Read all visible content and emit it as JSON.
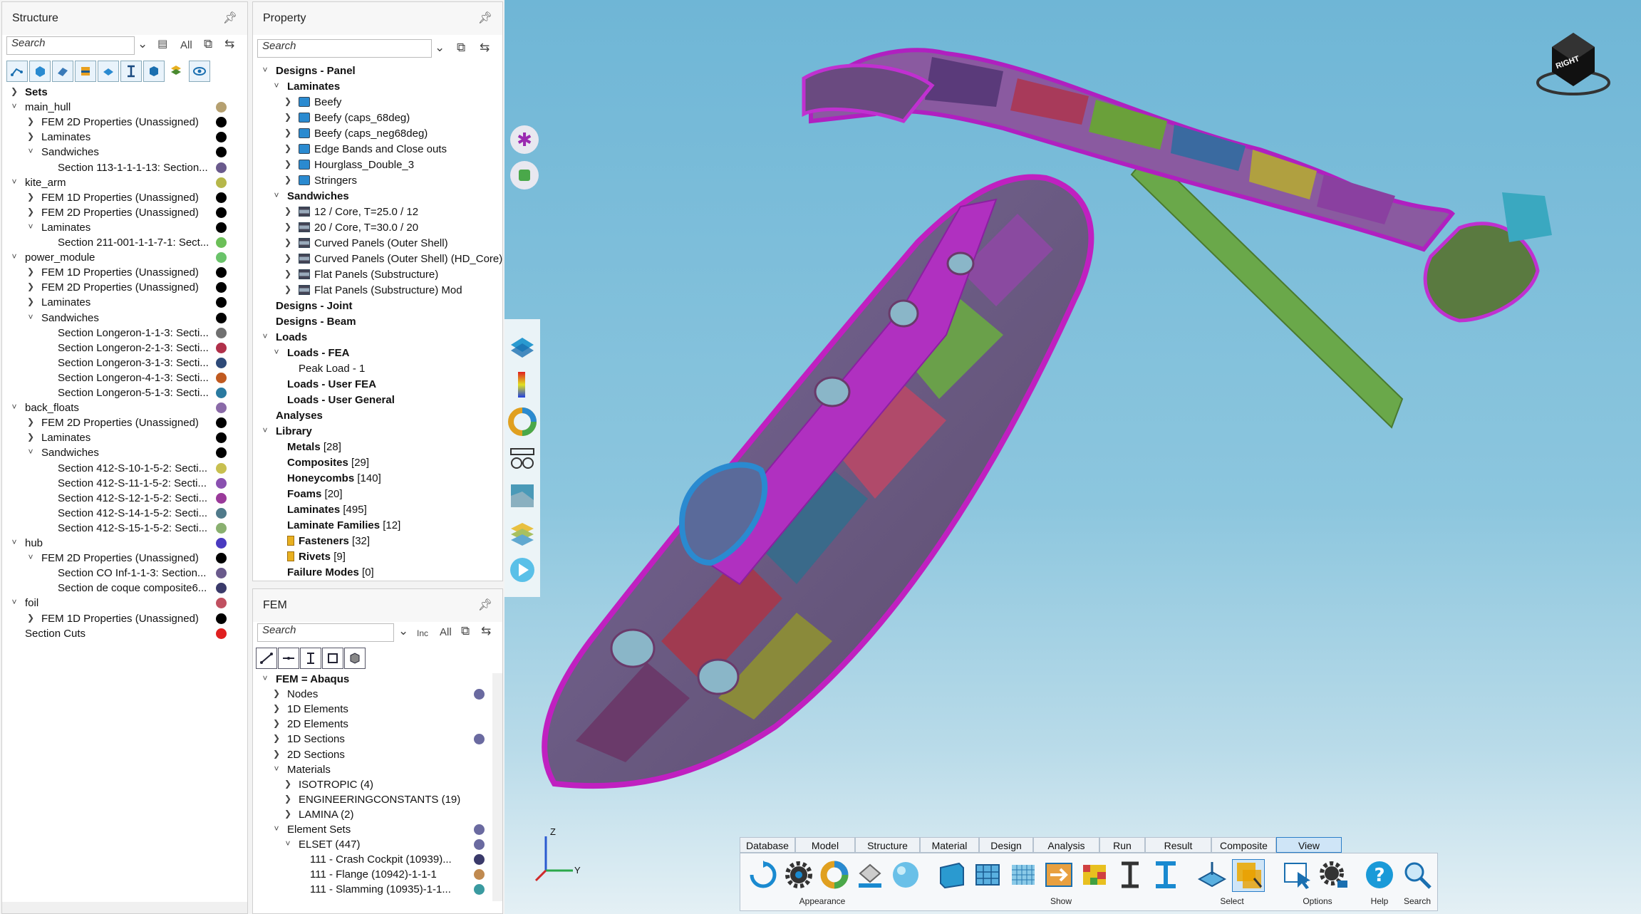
{
  "structure": {
    "title": "Structure",
    "search_placeholder": "Search",
    "all_label": "All",
    "tree": [
      {
        "label": "Sets",
        "level": 0,
        "bold": true,
        "exp": "right"
      },
      {
        "label": "main_hull",
        "level": 0,
        "exp": "down",
        "dot": "#b5a070"
      },
      {
        "label": "FEM 2D Properties (Unassigned)",
        "level": 1,
        "exp": "right",
        "dot": "#000000"
      },
      {
        "label": "Laminates",
        "level": 1,
        "exp": "right",
        "dot": "#000000"
      },
      {
        "label": "Sandwiches",
        "level": 1,
        "exp": "down",
        "dot": "#000000"
      },
      {
        "label": "Section 113-1-1-1-13: Section...",
        "level": 2,
        "dot": "#6a5a8c"
      },
      {
        "label": "kite_arm",
        "level": 0,
        "exp": "down",
        "dot": "#b6b74a"
      },
      {
        "label": "FEM 1D Properties (Unassigned)",
        "level": 1,
        "exp": "right",
        "dot": "#000000"
      },
      {
        "label": "FEM 2D Properties (Unassigned)",
        "level": 1,
        "exp": "right",
        "dot": "#000000"
      },
      {
        "label": "Laminates",
        "level": 1,
        "exp": "down",
        "dot": "#000000"
      },
      {
        "label": "Section 211-001-1-1-7-1: Sect...",
        "level": 2,
        "dot": "#6cbf58"
      },
      {
        "label": "power_module",
        "level": 0,
        "exp": "down",
        "dot": "#6ac36a"
      },
      {
        "label": "FEM 1D Properties (Unassigned)",
        "level": 1,
        "exp": "right",
        "dot": "#000000"
      },
      {
        "label": "FEM 2D Properties (Unassigned)",
        "level": 1,
        "exp": "right",
        "dot": "#000000"
      },
      {
        "label": "Laminates",
        "level": 1,
        "exp": "right",
        "dot": "#000000"
      },
      {
        "label": "Sandwiches",
        "level": 1,
        "exp": "down",
        "dot": "#000000"
      },
      {
        "label": "Section Longeron-1-1-3: Secti...",
        "level": 2,
        "dot": "#707070"
      },
      {
        "label": "Section Longeron-2-1-3: Secti...",
        "level": 2,
        "dot": "#b0304a"
      },
      {
        "label": "Section Longeron-3-1-3: Secti...",
        "level": 2,
        "dot": "#2e4a78"
      },
      {
        "label": "Section Longeron-4-1-3: Secti...",
        "level": 2,
        "dot": "#c05a20"
      },
      {
        "label": "Section Longeron-5-1-3: Secti...",
        "level": 2,
        "dot": "#2a7aa0"
      },
      {
        "label": "back_floats",
        "level": 0,
        "exp": "down",
        "dot": "#8a6aa8"
      },
      {
        "label": "FEM 2D Properties (Unassigned)",
        "level": 1,
        "exp": "right",
        "dot": "#000000"
      },
      {
        "label": "Laminates",
        "level": 1,
        "exp": "right",
        "dot": "#000000"
      },
      {
        "label": "Sandwiches",
        "level": 1,
        "exp": "down",
        "dot": "#000000"
      },
      {
        "label": "Section 412-S-10-1-5-2: Secti...",
        "level": 2,
        "dot": "#c8c050"
      },
      {
        "label": "Section 412-S-11-1-5-2: Secti...",
        "level": 2,
        "dot": "#8a50b0"
      },
      {
        "label": "Section 412-S-12-1-5-2: Secti...",
        "level": 2,
        "dot": "#9a3a9a"
      },
      {
        "label": "Section 412-S-14-1-5-2: Secti...",
        "level": 2,
        "dot": "#507a8a"
      },
      {
        "label": "Section 412-S-15-1-5-2: Secti...",
        "level": 2,
        "dot": "#8ab070"
      },
      {
        "label": "hub",
        "level": 0,
        "exp": "down",
        "dot": "#4a3ac0"
      },
      {
        "label": "FEM 2D Properties (Unassigned)",
        "level": 1,
        "exp": "down",
        "dot": "#000000"
      },
      {
        "label": "Section CO Inf-1-1-3: Section...",
        "level": 2,
        "dot": "#6a5a8c"
      },
      {
        "label": "Section de coque composite6...",
        "level": 2,
        "dot": "#3a3a6a"
      },
      {
        "label": "foil",
        "level": 0,
        "exp": "down",
        "dot": "#c05060"
      },
      {
        "label": "FEM 1D Properties (Unassigned)",
        "level": 1,
        "exp": "right",
        "dot": "#000000"
      },
      {
        "label": "Section Cuts",
        "level": 0,
        "dot": "#e02020"
      }
    ]
  },
  "property": {
    "title": "Property",
    "search_placeholder": "Search",
    "tree": [
      {
        "label": "Designs - Panel",
        "level": 0,
        "bold": true,
        "exp": "down"
      },
      {
        "label": "Laminates",
        "level": 1,
        "bold": true,
        "exp": "down"
      },
      {
        "label": "Beefy",
        "level": 2,
        "exp": "right",
        "icon": "lam"
      },
      {
        "label": "Beefy (caps_68deg)",
        "level": 2,
        "exp": "right",
        "icon": "lam"
      },
      {
        "label": "Beefy (caps_neg68deg)",
        "level": 2,
        "exp": "right",
        "icon": "lam"
      },
      {
        "label": "Edge Bands and Close outs",
        "level": 2,
        "exp": "right",
        "icon": "lam"
      },
      {
        "label": "Hourglass_Double_3",
        "level": 2,
        "exp": "right",
        "icon": "lam"
      },
      {
        "label": "Stringers",
        "level": 2,
        "exp": "right",
        "icon": "lam"
      },
      {
        "label": "Sandwiches",
        "level": 1,
        "bold": true,
        "exp": "down"
      },
      {
        "label": "12 / Core, T=25.0 / 12",
        "level": 2,
        "exp": "right",
        "icon": "sand"
      },
      {
        "label": "20 / Core, T=30.0 / 20",
        "level": 2,
        "exp": "right",
        "icon": "sand"
      },
      {
        "label": "Curved Panels (Outer Shell)",
        "level": 2,
        "exp": "right",
        "icon": "sand"
      },
      {
        "label": "Curved Panels (Outer Shell) (HD_Core)",
        "level": 2,
        "exp": "right",
        "icon": "sand"
      },
      {
        "label": "Flat Panels (Substructure)",
        "level": 2,
        "exp": "right",
        "icon": "sand"
      },
      {
        "label": "Flat Panels (Substructure) Mod",
        "level": 2,
        "exp": "right",
        "icon": "sand"
      },
      {
        "label": "Designs - Joint",
        "level": 0,
        "bold": true
      },
      {
        "label": "Designs - Beam",
        "level": 0,
        "bold": true
      },
      {
        "label": "Loads",
        "level": 0,
        "bold": true,
        "exp": "down"
      },
      {
        "label": "Loads - FEA",
        "level": 1,
        "bold": true,
        "exp": "down"
      },
      {
        "label": "Peak Load - 1",
        "level": 2
      },
      {
        "label": "Loads - User FEA",
        "level": 1,
        "bold": true
      },
      {
        "label": "Loads - User General",
        "level": 1,
        "bold": true
      },
      {
        "label": "Analyses",
        "level": 0,
        "bold": true
      },
      {
        "label": "Library",
        "level": 0,
        "bold": true,
        "exp": "down"
      },
      {
        "label": "Metals",
        "count": " [28]",
        "level": 1,
        "bold": true
      },
      {
        "label": "Composites",
        "count": " [29]",
        "level": 1,
        "bold": true
      },
      {
        "label": "Honeycombs",
        "count": " [140]",
        "level": 1,
        "bold": true
      },
      {
        "label": "Foams",
        "count": " [20]",
        "level": 1,
        "bold": true
      },
      {
        "label": "Laminates",
        "count": " [495]",
        "level": 1,
        "bold": true
      },
      {
        "label": "Laminate Families",
        "count": " [12]",
        "level": 1,
        "bold": true
      },
      {
        "label": "Fasteners",
        "count": " [32]",
        "level": 1,
        "bold": true,
        "icon": "fast"
      },
      {
        "label": "Rivets",
        "count": " [9]",
        "level": 1,
        "bold": true,
        "icon": "fast"
      },
      {
        "label": "Failure Modes",
        "count": " [0]",
        "level": 1,
        "bold": true
      }
    ]
  },
  "fem": {
    "title": "FEM",
    "search_placeholder": "Search",
    "inc_label": "Inc",
    "all_label": "All",
    "tree": [
      {
        "label": "FEM = Abaqus",
        "level": 0,
        "bold": true,
        "exp": "down"
      },
      {
        "label": "Nodes",
        "level": 1,
        "exp": "right",
        "dot": "#6a6aa0"
      },
      {
        "label": "1D Elements",
        "level": 1,
        "exp": "right"
      },
      {
        "label": "2D Elements",
        "level": 1,
        "exp": "right"
      },
      {
        "label": "1D Sections",
        "level": 1,
        "exp": "right",
        "dot": "#6a6aa0"
      },
      {
        "label": "2D Sections",
        "level": 1,
        "exp": "right"
      },
      {
        "label": "Materials",
        "level": 1,
        "exp": "down"
      },
      {
        "label": "ISOTROPIC (4)",
        "level": 2,
        "exp": "right"
      },
      {
        "label": "ENGINEERINGCONSTANTS (19)",
        "level": 2,
        "exp": "right"
      },
      {
        "label": "LAMINA (2)",
        "level": 2,
        "exp": "right"
      },
      {
        "label": "Element Sets",
        "level": 1,
        "exp": "down",
        "dot": "#6a6aa0"
      },
      {
        "label": "ELSET (447)",
        "level": 2,
        "exp": "down",
        "dot": "#6a6aa0"
      },
      {
        "label": "111 - Crash Cockpit (10939)...",
        "level": 3,
        "dot": "#3a3a6a"
      },
      {
        "label": "111 - Flange (10942)-1-1-1",
        "level": 3,
        "dot": "#c08a50"
      },
      {
        "label": "111 - Slamming (10935)-1-1...",
        "level": 3,
        "dot": "#3a9aa0"
      }
    ]
  },
  "ribbon": {
    "tabs": [
      "Database",
      "Model",
      "Structure",
      "Material",
      "Design",
      "Analysis",
      "Run",
      "Result",
      "Composite",
      "View"
    ],
    "active_tab": "View",
    "groups": [
      "Appearance",
      "Show",
      "Select",
      "Options",
      "Help",
      "Search"
    ]
  },
  "viewcube": {
    "face_label": "RIGHT"
  },
  "axes": {
    "z": "Z",
    "y": "Y"
  },
  "colors": {
    "accent": "#2a7ec8",
    "selection": "#cfe5f7"
  }
}
